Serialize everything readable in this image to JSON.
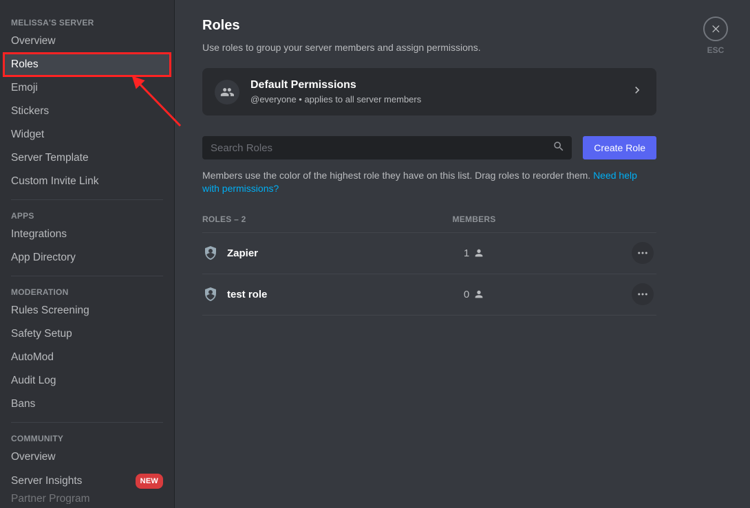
{
  "sidebar": {
    "server_name": "MELISSA'S SERVER",
    "items_server": [
      "Overview",
      "Roles",
      "Emoji",
      "Stickers",
      "Widget",
      "Server Template",
      "Custom Invite Link"
    ],
    "apps_header": "APPS",
    "items_apps": [
      "Integrations",
      "App Directory"
    ],
    "mod_header": "MODERATION",
    "items_mod": [
      "Rules Screening",
      "Safety Setup",
      "AutoMod",
      "Audit Log",
      "Bans"
    ],
    "community_header": "COMMUNITY",
    "items_community": [
      "Overview",
      "Server Insights",
      "Partner Program"
    ],
    "new_badge": "NEW"
  },
  "close": {
    "esc": "ESC"
  },
  "page": {
    "title": "Roles",
    "subtitle": "Use roles to group your server members and assign permissions."
  },
  "default_card": {
    "title": "Default Permissions",
    "subtitle": "@everyone • applies to all server members"
  },
  "search": {
    "placeholder": "Search Roles",
    "create_label": "Create Role"
  },
  "hint": {
    "text": "Members use the color of the highest role they have on this list. Drag roles to reorder them. ",
    "link": "Need help with permissions?"
  },
  "list": {
    "roles_header": "ROLES – 2",
    "members_header": "MEMBERS",
    "rows": [
      {
        "name": "Zapier",
        "members": "1"
      },
      {
        "name": "test role",
        "members": "0"
      }
    ]
  }
}
